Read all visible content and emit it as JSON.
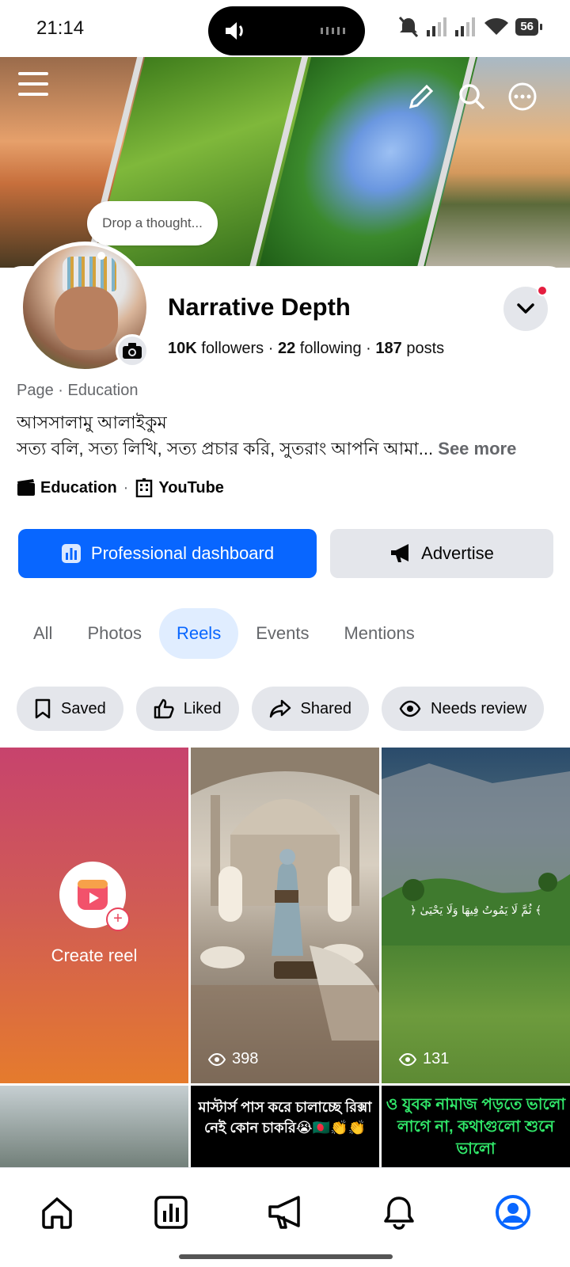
{
  "status_bar": {
    "time": "21:14",
    "battery": "56"
  },
  "cover": {
    "thought_placeholder": "Drop a thought..."
  },
  "profile": {
    "name": "Narrative Depth",
    "followers_count": "10K",
    "followers_label": "followers",
    "following_count": "22",
    "following_label": "following",
    "posts_count": "187",
    "posts_label": "posts",
    "category": "Page · Education",
    "bio_line1": "আসসালামু আলাইকুম",
    "bio_line2": "সত্য বলি, সত্য লিখি, সত্য প্রচার করি, সুতরাং আপনি আমা...",
    "see_more": "See more",
    "link1": "Education",
    "link2": "YouTube"
  },
  "actions": {
    "dashboard": "Professional dashboard",
    "advertise": "Advertise"
  },
  "tabs": [
    {
      "label": "All",
      "active": false
    },
    {
      "label": "Photos",
      "active": false
    },
    {
      "label": "Reels",
      "active": true
    },
    {
      "label": "Events",
      "active": false
    },
    {
      "label": "Mentions",
      "active": false
    }
  ],
  "filters": [
    {
      "label": "Saved",
      "icon": "bookmark-icon"
    },
    {
      "label": "Liked",
      "icon": "thumbs-up-icon"
    },
    {
      "label": "Shared",
      "icon": "share-icon"
    },
    {
      "label": "Needs review",
      "icon": "eye-icon"
    }
  ],
  "reels": {
    "create_label": "Create reel",
    "reel1_views": "398",
    "reel2_views": "131",
    "reel4_text": "মাস্টার্স পাস করে চালাচ্ছে রিক্সা নেই কোন চাকরি😭🇧🇩👏👏",
    "reel5_text": "ও যুবক নামাজ পড়তে ভালো লাগে না, কথাগুলো শুনে ভালো"
  },
  "colors": {
    "accent": "#0866ff",
    "chip_bg": "#e4e6eb",
    "active_tab_bg": "#e0edff",
    "notification": "#e41e3f"
  }
}
